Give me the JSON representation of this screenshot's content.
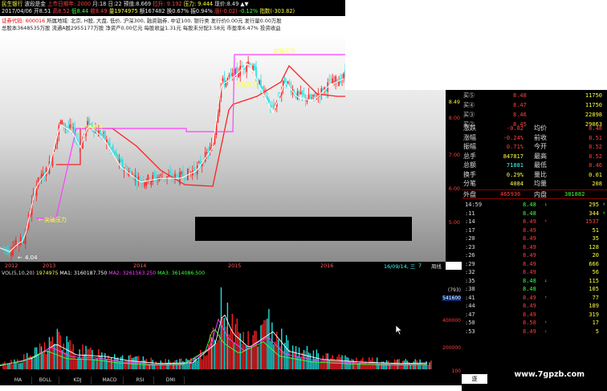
{
  "header": {
    "title": "民生银行",
    "line1_a": "波段是金",
    "line1_b": "上市日期年: 2000",
    "line1_c": "月:18",
    "line1_d": "日:22",
    "line1_e": "预值:8.669",
    "line1_f": "拉升: 9.192",
    "line1_g": "压力: 9.444",
    "line1_h": "现价:8.49",
    "line2_a": "2017/04/06",
    "line2_b": "开8.51",
    "line2_c": "高8.52",
    "line2_d": "低8.44",
    "line2_e": "收8.49",
    "line2_f": "量1974975",
    "line2_g": "额167482",
    "line2_h": "换0.67%",
    "line2_i": "振0.94%",
    "line2_j": "涨(-0.02)",
    "line2_k": "-0.12%",
    "line2_l": "指数(-303.82)"
  },
  "info": {
    "line1_a": "证券代码: 600016",
    "line1_b": "所属地域: 北京, H股, 大盘, 低价, 沪深300, 融资融券, 中证100, 银行类",
    "line1_c": "发行价0.00元",
    "line1_d": "发行量0.00万股",
    "line2_a": "总股本3648535万股",
    "line2_b": "流通A股2955177万股",
    "line2_c": "净资产0.00亿元",
    "line2_d": "每股收益1.31元",
    "line2_e": "每股未分配3.58元",
    "line2_f": "市盈率6.47%",
    "line2_g": "投资收益"
  },
  "chart_labels": {
    "break_1": "突破压力",
    "break_2": "突破压",
    "break_3": "突破压力",
    "break_4": "突破压力",
    "start_price": "4.04"
  },
  "price_axis": [
    "8.49",
    "8.00",
    "7.00",
    "6.00",
    "5.00"
  ],
  "date_axis": {
    "ticks": [
      "2012",
      "2013",
      "2014",
      "2015",
      "2016"
    ],
    "current": "16/09/14, 三",
    "current_suffix": "7",
    "tail": "周线"
  },
  "volume": {
    "title": "VOL(5,10,20)",
    "vol": "1974975",
    "ma1": "MA1: 3160187.750",
    "ma2": "MA2: 3261563.250",
    "ma3": "MA3: 3614086.500",
    "axis_labels": [
      "(793)",
      "541600",
      "400000",
      "200000",
      "100"
    ]
  },
  "tabs": [
    "MA",
    "BOLL",
    "KDJ",
    "MACD",
    "RSI",
    "DMI"
  ],
  "quotes": {
    "bids": [
      {
        "label": "买⑤",
        "price": "8.48",
        "vol": "11750"
      },
      {
        "label": "买④",
        "price": "8.47",
        "vol": "11750"
      },
      {
        "label": "买③",
        "price": "8.46",
        "vol": "22898"
      },
      {
        "label": "买②",
        "price": "8.45",
        "vol": "29063"
      }
    ],
    "stats": [
      {
        "k1": "涨跌",
        "v1": "-0.02",
        "k2": "均价",
        "v2": "8.48"
      },
      {
        "k1": "涨幅",
        "v1": "-0.24%",
        "k2": "前收",
        "v2": "8.51"
      },
      {
        "k1": "振幅",
        "v1": "0.71%",
        "k2": "今开",
        "v2": "8.52"
      },
      {
        "k1": "总手",
        "v1": "847817",
        "k2": "最高",
        "v2": "8.52"
      },
      {
        "k1": "总额",
        "v1": "71881",
        "k2": "最低",
        "v2": "8.46"
      },
      {
        "k1": "换手",
        "v1": "0.29%",
        "k2": "量比",
        "v2": "0.01"
      },
      {
        "k1": "分笔",
        "v1": "4084",
        "k2": "均量",
        "v2": "208"
      }
    ],
    "outer": {
      "k1": "外盘",
      "v1": "465936",
      "k2": "内盘",
      "v2": "381882"
    },
    "ticks": [
      {
        "time": "14:59",
        "price": "8.48",
        "dir": "↓",
        "vol": "295",
        "arrow": "↑"
      },
      {
        "time": ":11",
        "price": "8.48",
        "dir": "",
        "vol": "344",
        "arrow": "↑"
      },
      {
        "time": ":14",
        "price": "8.49",
        "dir": "↑",
        "vol": "1537",
        "arrow": ""
      },
      {
        "time": ":17",
        "price": "8.49",
        "dir": "",
        "vol": "51",
        "arrow": ""
      },
      {
        "time": ":20",
        "price": "8.49",
        "dir": "",
        "vol": "35",
        "arrow": ""
      },
      {
        "time": ":23",
        "price": "8.49",
        "dir": "",
        "vol": "128",
        "arrow": ""
      },
      {
        "time": ":26",
        "price": "8.49",
        "dir": "",
        "vol": "20",
        "arrow": ""
      },
      {
        "time": ":29",
        "price": "8.49",
        "dir": "",
        "vol": "666",
        "arrow": ""
      },
      {
        "time": ":32",
        "price": "8.49",
        "dir": "",
        "vol": "56",
        "arrow": ""
      },
      {
        "time": ":35",
        "price": "8.48",
        "dir": "↓",
        "vol": "115",
        "arrow": ""
      },
      {
        "time": ":38",
        "price": "8.48",
        "dir": "",
        "vol": "105",
        "arrow": ""
      },
      {
        "time": ":41",
        "price": "8.49",
        "dir": "↑",
        "vol": "77",
        "arrow": ""
      },
      {
        "time": ":44",
        "price": "8.49",
        "dir": "",
        "vol": "189",
        "arrow": ""
      },
      {
        "time": ":47",
        "price": "8.49",
        "dir": "",
        "vol": "319",
        "arrow": ""
      },
      {
        "time": ":50",
        "price": "8.50",
        "dir": "↑",
        "vol": "17",
        "arrow": ""
      },
      {
        "time": ":53",
        "price": "8.49",
        "dir": "↓",
        "vol": "5",
        "arrow": ""
      }
    ]
  },
  "footer": {
    "watermark": "www.7gpzb.com",
    "tab": "逐"
  },
  "colors": {
    "up": "#ff4040",
    "down": "#40ffff",
    "ma_pink": "#ff40ff",
    "price_yellow": "#ffff40",
    "bg": "#000000"
  }
}
